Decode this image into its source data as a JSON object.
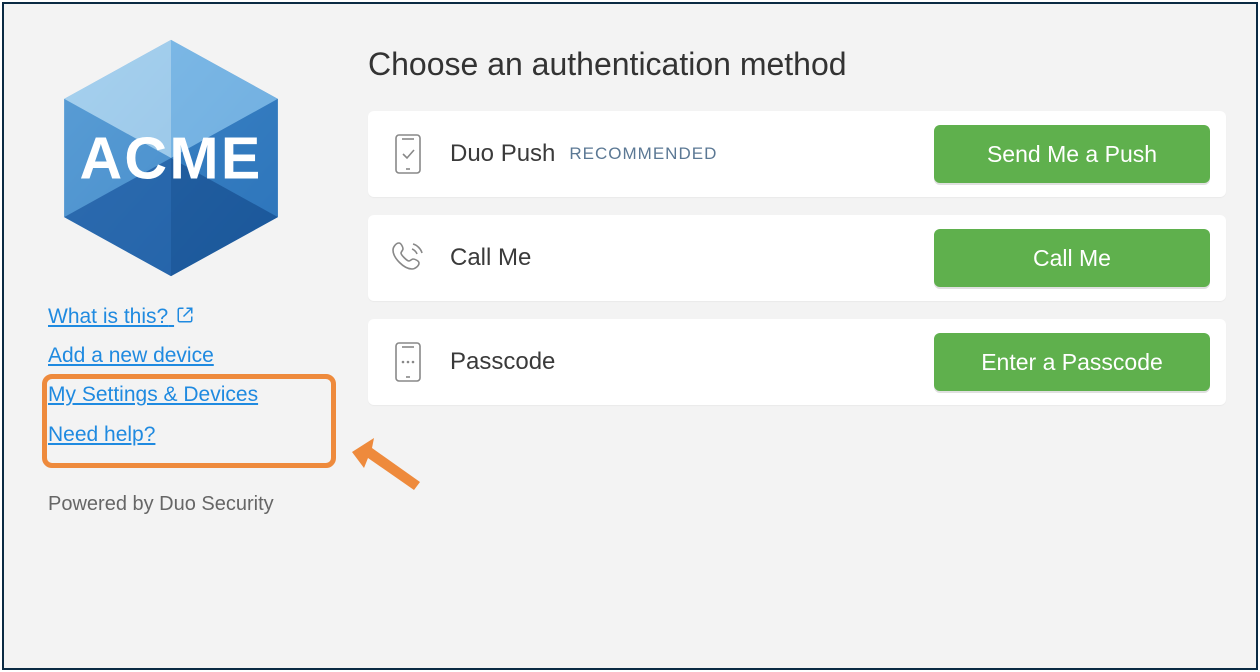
{
  "brand": {
    "logo_text": "ACME"
  },
  "sidebar": {
    "links": {
      "what_is_this": "What is this?",
      "add_device": "Add a new device",
      "settings_devices": "My Settings & Devices",
      "need_help": "Need help?"
    },
    "powered_by": "Powered by Duo Security"
  },
  "main": {
    "heading": "Choose an authentication method",
    "methods": [
      {
        "icon": "phone-check-icon",
        "label": "Duo Push",
        "tag": "RECOMMENDED",
        "button": "Send Me a Push"
      },
      {
        "icon": "phone-ring-icon",
        "label": "Call Me",
        "tag": "",
        "button": "Call Me"
      },
      {
        "icon": "phone-code-icon",
        "label": "Passcode",
        "tag": "",
        "button": "Enter a Passcode"
      }
    ]
  },
  "colors": {
    "accent_green": "#5fb04d",
    "link_blue": "#1f8ae0",
    "annotation_orange": "#ee8a3c"
  }
}
